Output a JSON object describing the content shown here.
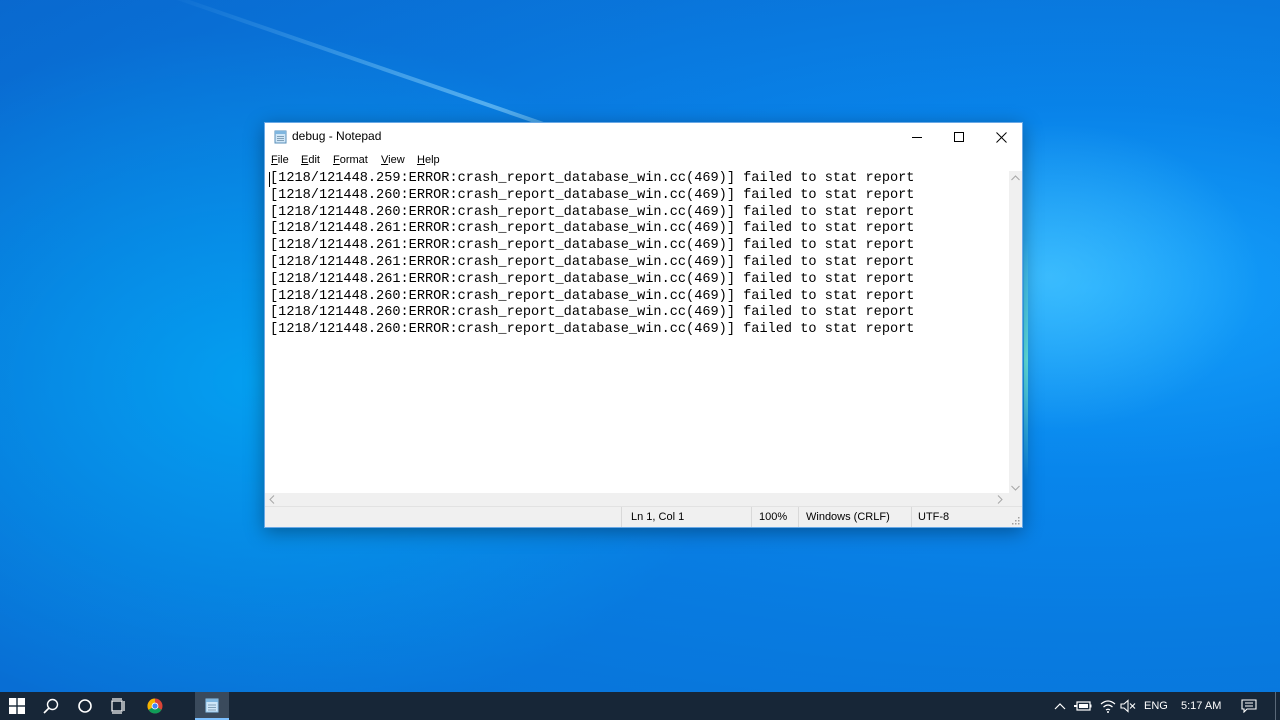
{
  "window": {
    "title": "debug - Notepad",
    "menu": [
      "File",
      "Edit",
      "Format",
      "View",
      "Help"
    ]
  },
  "editor": {
    "lines": [
      "[1218/121448.259:ERROR:crash_report_database_win.cc(469)] failed to stat report",
      "[1218/121448.260:ERROR:crash_report_database_win.cc(469)] failed to stat report",
      "[1218/121448.260:ERROR:crash_report_database_win.cc(469)] failed to stat report",
      "[1218/121448.261:ERROR:crash_report_database_win.cc(469)] failed to stat report",
      "[1218/121448.261:ERROR:crash_report_database_win.cc(469)] failed to stat report",
      "[1218/121448.261:ERROR:crash_report_database_win.cc(469)] failed to stat report",
      "[1218/121448.261:ERROR:crash_report_database_win.cc(469)] failed to stat report",
      "[1218/121448.260:ERROR:crash_report_database_win.cc(469)] failed to stat report",
      "[1218/121448.260:ERROR:crash_report_database_win.cc(469)] failed to stat report",
      "[1218/121448.260:ERROR:crash_report_database_win.cc(469)] failed to stat report"
    ]
  },
  "status": {
    "position": "Ln 1, Col 1",
    "zoom": "100%",
    "line_endings": "Windows (CRLF)",
    "encoding": "UTF-8"
  },
  "taskbar": {
    "icons": [
      "windows-start-icon",
      "search-icon",
      "cortana-icon",
      "task-view-icon",
      "chrome-icon",
      "notepad-icon"
    ],
    "tray": {
      "language": "ENG",
      "time": "5:17 AM"
    }
  },
  "colors": {
    "taskbar": "#172637",
    "window_border": "#6aa9e6",
    "statusbar": "#f0f0f0"
  }
}
